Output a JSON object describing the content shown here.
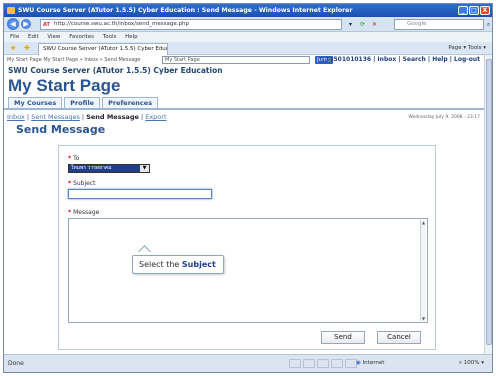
{
  "window": {
    "title": "SWU Course Server (ATutor 1.5.5) Cyber Education : Send Message - Windows Internet Explorer",
    "minimize": "_",
    "maximize": "□",
    "close": "X"
  },
  "address": {
    "url": "http://course.swu.ac.th/inbox/send_message.php",
    "url_prefix": "AT",
    "search_placeholder": "Google"
  },
  "menu": [
    "File",
    "Edit",
    "View",
    "Favorites",
    "Tools",
    "Help"
  ],
  "browser_tab": {
    "label": "SWU Course Server (ATutor 1.5.5) Cyber Education : ...",
    "commands": "Page ▾  Tools ▾"
  },
  "jumpbar": {
    "breadcrumb": "My Start Page  My Start Page » Inbox » Send Message",
    "select_value": "My Start Page",
    "jump_label": "Jump",
    "user_links": "✩ sc501010136 | Inbox | Search | Help | Log-out"
  },
  "page": {
    "course_title": "SWU Course Server (ATutor 1.5.5) Cyber Education",
    "start_title": "My Start Page",
    "tabs": [
      "My Courses",
      "Profile",
      "Preferences"
    ],
    "subnav": {
      "inbox": "Inbox",
      "sent": "Sent Messages",
      "send": "Send Message",
      "export": "Export",
      "sep": " | "
    },
    "date": "Wednesday July 9, 2008 - 23:17",
    "heading": "Send Message"
  },
  "form": {
    "required_mark": "*",
    "to_label": "To",
    "to_value": "ใหมพร วารดยาคม",
    "subject_label": "Subject",
    "message_label": "Message",
    "send_label": "Send",
    "cancel_label": "Cancel"
  },
  "callout": {
    "prefix": "Select the ",
    "bold": "Subject"
  },
  "status": {
    "left": "Done",
    "zone": "Internet",
    "zoom": "100%"
  }
}
